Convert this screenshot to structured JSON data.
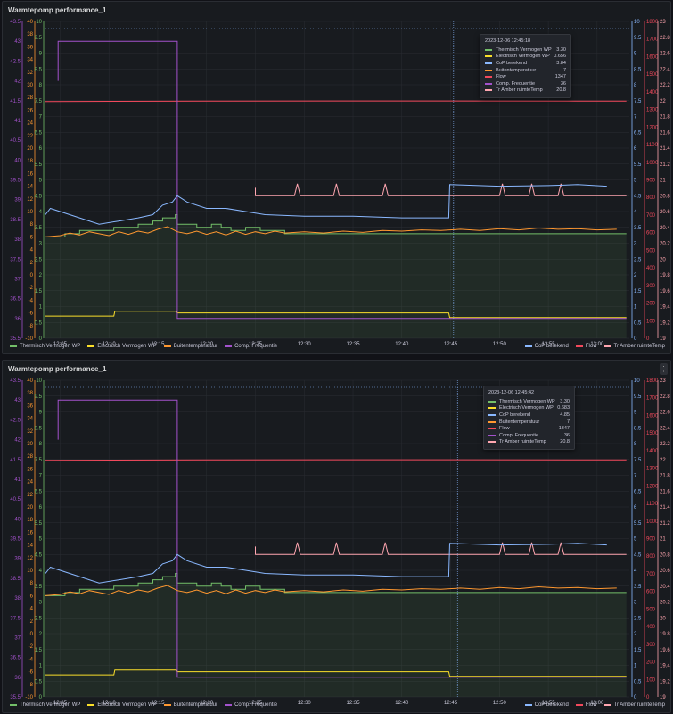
{
  "panels": [
    {
      "title": "Warmtepomp performance_1",
      "tooltip": {
        "time": "2023-12-06 12:45:18",
        "values": [
          "3.30",
          "0.656",
          "3.84",
          "7",
          "1347",
          "36",
          "20.8"
        ]
      }
    },
    {
      "title": "Warmtepomp performance_1",
      "tooltip": {
        "time": "2023-12-06 12:45:42",
        "values": [
          "3.30",
          "0.683",
          "4.85",
          "7",
          "1347",
          "36",
          "20.8"
        ]
      }
    }
  ],
  "series": [
    {
      "name": "Thermisch Vermogen WP",
      "color": "#73bf69"
    },
    {
      "name": "Electrisch Vermogen WP",
      "color": "#fade2a"
    },
    {
      "name": "CoP berekend",
      "color": "#8ab8ff"
    },
    {
      "name": "Buitentemperatuur",
      "color": "#ff9830"
    },
    {
      "name": "Flow",
      "color": "#f2495c"
    },
    {
      "name": "Comp. Frequentie",
      "color": "#a352cc"
    },
    {
      "name": "Tr Amber ruimteTemp",
      "color": "#ffa6b0"
    }
  ],
  "legend_left": [
    0,
    1,
    3,
    5
  ],
  "legend_right": [
    2,
    4,
    6
  ],
  "x_ticks": [
    "12:05",
    "12:10",
    "12:15",
    "12:20",
    "12:25",
    "12:30",
    "12:35",
    "12:40",
    "12:45",
    "12:50",
    "12:55",
    "13:00"
  ],
  "axes": {
    "purple": {
      "min": 35.5,
      "max": 43.5,
      "step": 0.5,
      "color": "#a352cc"
    },
    "orange": {
      "min": -10,
      "max": 40,
      "step": 2,
      "color": "#ff9830"
    },
    "green": {
      "min": 0,
      "max": 10,
      "step": 0.5,
      "color": "#73bf69"
    },
    "blue": {
      "min": 0,
      "max": 10,
      "step": 0.5,
      "color": "#8ab8ff"
    },
    "red": {
      "min": 0,
      "max": 1800,
      "step": 100,
      "color": "#f2495c"
    },
    "pink": {
      "min": 19,
      "max": 23,
      "step": 0.2,
      "color": "#ffa6b0"
    }
  },
  "chart_data": {
    "type": "line",
    "x_unit": "minutes after 12:00",
    "xlim": [
      3.5,
      63.3
    ],
    "thermisch": [
      [
        3.5,
        3.2
      ],
      [
        5.5,
        3.3
      ],
      [
        7,
        3.4
      ],
      [
        10,
        3.4
      ],
      [
        10.5,
        3.5
      ],
      [
        12,
        3.5
      ],
      [
        13,
        3.6
      ],
      [
        14.5,
        3.7
      ],
      [
        15.5,
        3.8
      ],
      [
        16.8,
        3.9
      ],
      [
        17,
        3.6
      ],
      [
        19,
        3.5
      ],
      [
        20.5,
        3.6
      ],
      [
        21.5,
        3.5
      ],
      [
        22.5,
        3.4
      ],
      [
        24,
        3.5
      ],
      [
        25.5,
        3.4
      ],
      [
        27,
        3.4
      ],
      [
        28,
        3.3
      ],
      [
        63,
        3.3
      ]
    ],
    "electrisch": [
      [
        3.5,
        0.7
      ],
      [
        10.5,
        0.7
      ],
      [
        10.6,
        0.85
      ],
      [
        16.9,
        0.85
      ],
      [
        17,
        0.8
      ],
      [
        44.8,
        0.8
      ],
      [
        44.9,
        0.656
      ],
      [
        63,
        0.656
      ]
    ],
    "cop": [
      [
        3.5,
        3.9
      ],
      [
        4,
        4.1
      ],
      [
        5,
        4.0
      ],
      [
        7,
        3.8
      ],
      [
        9,
        3.6
      ],
      [
        11,
        3.7
      ],
      [
        13,
        3.8
      ],
      [
        14.5,
        3.9
      ],
      [
        15.5,
        4.2
      ],
      [
        16.5,
        4.3
      ],
      [
        17,
        4.5
      ],
      [
        18,
        4.3
      ],
      [
        20,
        4.1
      ],
      [
        22,
        4.1
      ],
      [
        24,
        4.0
      ],
      [
        26,
        3.9
      ],
      [
        30,
        3.85
      ],
      [
        35,
        3.85
      ],
      [
        40,
        3.8
      ],
      [
        44.8,
        3.8
      ],
      [
        44.9,
        4.85
      ],
      [
        50,
        4.8
      ],
      [
        55,
        4.82
      ],
      [
        58,
        4.85
      ],
      [
        61,
        4.8
      ]
    ],
    "buiten": [
      [
        3.5,
        6
      ],
      [
        5,
        6.2
      ],
      [
        6,
        6.6
      ],
      [
        7,
        6.3
      ],
      [
        8,
        6.8
      ],
      [
        9,
        6.5
      ],
      [
        10,
        6.2
      ],
      [
        11,
        6.8
      ],
      [
        12,
        6.4
      ],
      [
        13,
        6.9
      ],
      [
        14,
        6.6
      ],
      [
        15,
        7.2
      ],
      [
        16,
        7.6
      ],
      [
        17,
        6.8
      ],
      [
        18,
        6.5
      ],
      [
        19,
        6.9
      ],
      [
        20,
        6.4
      ],
      [
        21,
        6.8
      ],
      [
        22,
        6.3
      ],
      [
        23,
        6.9
      ],
      [
        24,
        6.4
      ],
      [
        25,
        6.8
      ],
      [
        26,
        6.5
      ],
      [
        27,
        6.9
      ],
      [
        28,
        6.6
      ],
      [
        30,
        6.8
      ],
      [
        32,
        6.6
      ],
      [
        34,
        6.9
      ],
      [
        36,
        6.7
      ],
      [
        38,
        7
      ],
      [
        40,
        6.9
      ],
      [
        42,
        7.1
      ],
      [
        44,
        7
      ],
      [
        46,
        7.2
      ],
      [
        48,
        7
      ],
      [
        50,
        7.3
      ],
      [
        52,
        7.1
      ],
      [
        54,
        7.4
      ],
      [
        56,
        7.2
      ],
      [
        58,
        7.3
      ],
      [
        60,
        7.1
      ],
      [
        62,
        7.2
      ]
    ],
    "flow": [
      [
        3.5,
        1345
      ],
      [
        20,
        1347
      ],
      [
        40,
        1348
      ],
      [
        63,
        1347
      ]
    ],
    "comp": [
      [
        4.8,
        42
      ],
      [
        4.8,
        43
      ],
      [
        17,
        43
      ],
      [
        17,
        36
      ],
      [
        63,
        36
      ]
    ],
    "tramber": [
      [
        25,
        20.9
      ],
      [
        25,
        20.8
      ],
      [
        29,
        20.8
      ],
      [
        29.3,
        20.95
      ],
      [
        29.6,
        20.8
      ],
      [
        33,
        20.8
      ],
      [
        33.3,
        20.95
      ],
      [
        33.6,
        20.8
      ],
      [
        38,
        20.8
      ],
      [
        38.3,
        20.95
      ],
      [
        38.6,
        20.8
      ],
      [
        50,
        20.8
      ],
      [
        50.3,
        20.95
      ],
      [
        50.6,
        20.8
      ],
      [
        53,
        20.8
      ],
      [
        53.3,
        20.95
      ],
      [
        53.6,
        20.8
      ],
      [
        56,
        20.8
      ],
      [
        56.3,
        20.95
      ],
      [
        56.6,
        20.8
      ],
      [
        63,
        20.8
      ]
    ]
  }
}
